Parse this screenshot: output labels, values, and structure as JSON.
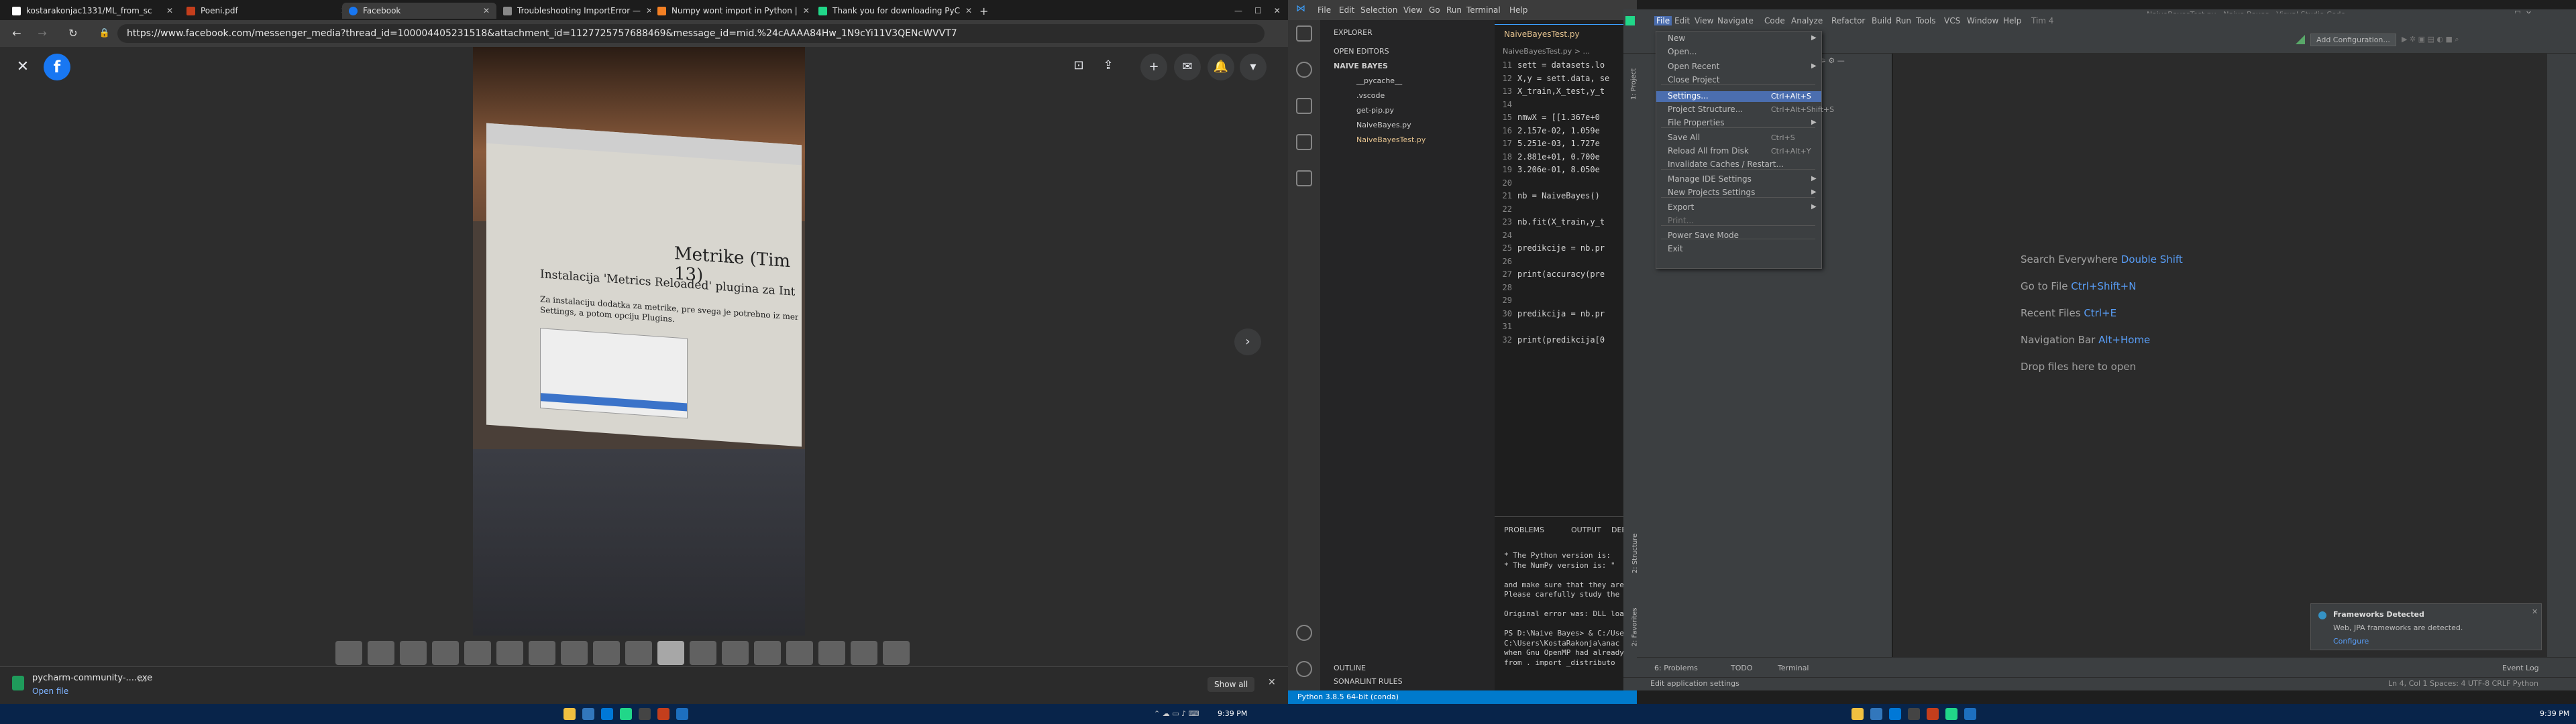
{
  "browser": {
    "tabs": [
      {
        "label": "kostarakonjac1331/ML_from_sc",
        "color": "#ffffff"
      },
      {
        "label": "Poeni.pdf",
        "color": "#c43e1c"
      },
      {
        "label": "Facebook",
        "color": "#1877f2"
      },
      {
        "label": "Troubleshooting ImportError —",
        "color": "#888888"
      },
      {
        "label": "Numpy wont import in Python |",
        "color": "#f48024"
      },
      {
        "label": "Thank you for downloading PyC",
        "color": "#21d789"
      }
    ],
    "new_tab": "+",
    "url": "https://www.facebook.com/messenger_media?thread_id=100004405231518&attachment_id=1127725757688469&message_id=mid.%24cAAAA84Hw_1N9cYi11V3QENcWVVT7",
    "download": {
      "name": "pycharm-community-....exe",
      "open_label": "Open file",
      "show_all": "Show all"
    }
  },
  "photo": {
    "title": "Metrike (Tim 13)",
    "heading": "Instalacija 'Metrics Reloaded' plugina za IntelliJ",
    "body": "Za instalaciju dodatka za metrike, pre svega je potrebno iz menija izabrati",
    "body2": "Settings, a potom opciju Plugins."
  },
  "taskbar_left": {
    "time": "9:39 PM"
  },
  "taskbar_right": {
    "time": "9:39 PM"
  },
  "vscode": {
    "menu": [
      "File",
      "Edit",
      "Selection",
      "View",
      "Go",
      "Run",
      "Terminal",
      "Help"
    ],
    "explorer_title": "EXPLORER",
    "open_editors": "OPEN EDITORS",
    "folder": "NAIVE BAYES",
    "files": [
      "__pycache__",
      ".vscode",
      "get-pip.py",
      "NaiveBayes.py",
      "NaiveBayesTest.py"
    ],
    "tab": "NaiveBayesTest.py",
    "breadcrumb": "NaiveBayesTest.py > ...",
    "code": [
      {
        "n": "11",
        "t": "sett = datasets.lo"
      },
      {
        "n": "12",
        "t": "X,y = sett.data, se"
      },
      {
        "n": "13",
        "t": "X_train,X_test,y_t"
      },
      {
        "n": "14",
        "t": ""
      },
      {
        "n": "15",
        "t": "nmwX = [[1.367e+0"
      },
      {
        "n": "16",
        "t": " 2.157e-02, 1.059e"
      },
      {
        "n": "17",
        "t": " 5.251e-03, 1.727e"
      },
      {
        "n": "18",
        "t": " 2.881e+01, 0.700e"
      },
      {
        "n": "19",
        "t": " 3.206e-01, 8.050e"
      },
      {
        "n": "20",
        "t": ""
      },
      {
        "n": "21",
        "t": "nb = NaiveBayes()"
      },
      {
        "n": "22",
        "t": ""
      },
      {
        "n": "23",
        "t": "nb.fit(X_train,y_t"
      },
      {
        "n": "24",
        "t": ""
      },
      {
        "n": "25",
        "t": "predikcije = nb.pr"
      },
      {
        "n": "26",
        "t": ""
      },
      {
        "n": "27",
        "t": "print(accuracy(pre"
      },
      {
        "n": "28",
        "t": ""
      },
      {
        "n": "29",
        "t": ""
      },
      {
        "n": "30",
        "t": "predikcija = nb.pr"
      },
      {
        "n": "31",
        "t": ""
      },
      {
        "n": "32",
        "t": "print(predikcija[0"
      }
    ],
    "panel_tabs": [
      "PROBLEMS",
      "OUTPUT",
      "DEBU"
    ],
    "terminal": [
      " * The Python version is: ",
      " * The NumPy version is: \"",
      "",
      "and make sure that they are",
      "Please carefully study the ",
      "",
      "Original error was: DLL loa",
      "",
      "PS D:\\Naive Bayes> & C:/Use",
      "C:\\Users\\KostaRakonja\\anac",
      "when Gnu OpenMP had already",
      "  from . import _distributo"
    ],
    "outline": "OUTLINE",
    "sonarlint": "SONARLINT RULES",
    "status_python": "Python 3.8.5 64-bit (conda)"
  },
  "pycharm": {
    "title": "NaiveBayesTest.py - Naive Bayes - Visual Studio Code",
    "menu": [
      "File",
      "Edit",
      "View",
      "Navigate",
      "Code",
      "Analyze",
      "Refactor",
      "Build",
      "Run",
      "Tools",
      "VCS",
      "Window",
      "Help",
      "Tim 4"
    ],
    "add_config": "Add Configuration...",
    "hints": [
      {
        "label": "Search Everywhere",
        "key": "Double Shift"
      },
      {
        "label": "Go to File",
        "key": "Ctrl+Shift+N"
      },
      {
        "label": "Recent Files",
        "key": "Ctrl+E"
      },
      {
        "label": "Navigation Bar",
        "key": "Alt+Home"
      },
      {
        "label": "Drop files here to open",
        "key": ""
      }
    ],
    "file_menu": [
      {
        "label": "New",
        "shortcut": "",
        "arrow": true
      },
      {
        "label": "Open...",
        "shortcut": "",
        "arrow": false
      },
      {
        "label": "Open Recent",
        "shortcut": "",
        "arrow": true
      },
      {
        "label": "Close Project",
        "shortcut": "",
        "arrow": false
      },
      {
        "label": "Settings...",
        "shortcut": "Ctrl+Alt+S",
        "arrow": false
      },
      {
        "label": "Project Structure...",
        "shortcut": "Ctrl+Alt+Shift+S",
        "arrow": false
      },
      {
        "label": "File Properties",
        "shortcut": "",
        "arrow": true
      },
      {
        "label": "Save All",
        "shortcut": "Ctrl+S",
        "arrow": false
      },
      {
        "label": "Reload All from Disk",
        "shortcut": "Ctrl+Alt+Y",
        "arrow": false
      },
      {
        "label": "Invalidate Caches / Restart...",
        "shortcut": "",
        "arrow": false
      },
      {
        "label": "Manage IDE Settings",
        "shortcut": "",
        "arrow": true
      },
      {
        "label": "New Projects Settings",
        "shortcut": "",
        "arrow": true
      },
      {
        "label": "Export",
        "shortcut": "",
        "arrow": true
      },
      {
        "label": "Print...",
        "shortcut": "",
        "arrow": false
      },
      {
        "label": "Power Save Mode",
        "shortcut": "",
        "arrow": false
      },
      {
        "label": "Exit",
        "shortcut": "",
        "arrow": false
      }
    ],
    "bottom_tabs": [
      "6: Problems",
      "TODO",
      "Terminal"
    ],
    "event_log": "Event Log",
    "status_text": "Edit application settings",
    "status_right": "Ln 4, Col 1   Spaces: 4   UTF-8   CRLF   Python",
    "notification": {
      "title": "Frameworks Detected",
      "body": "Web, JPA frameworks are detected.",
      "link": "Configure"
    },
    "side_labels": [
      "1: Project",
      "2: Structure",
      "2: Favorites"
    ]
  }
}
